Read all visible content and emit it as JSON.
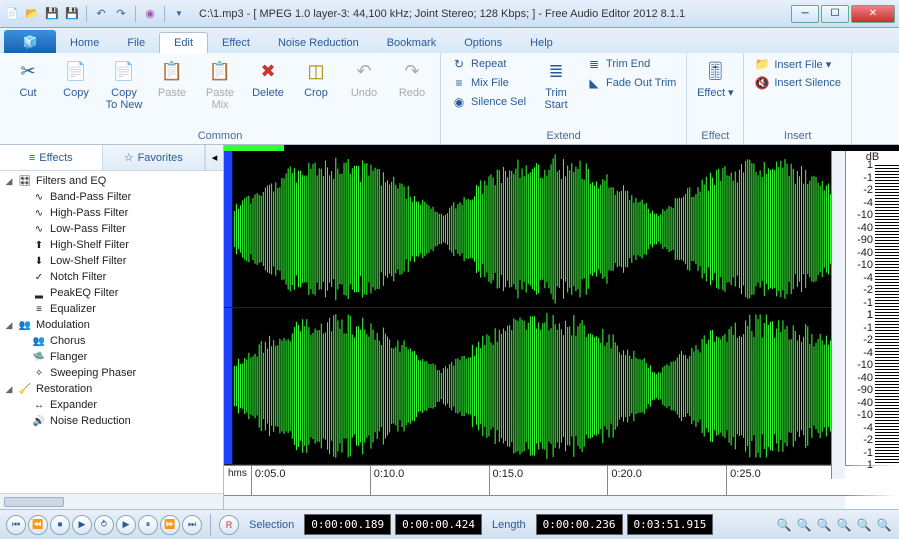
{
  "title": "C:\\1.mp3 - [ MPEG 1.0 layer-3: 44,100 kHz; Joint Stereo; 128 Kbps;  ] - Free Audio Editor 2012 8.1.1",
  "qat_icons": [
    "new",
    "open",
    "save",
    "disk",
    "undo",
    "redo",
    "cd",
    "help"
  ],
  "menu": {
    "tabs": [
      "Home",
      "File",
      "Edit",
      "Effect",
      "Noise Reduction",
      "Bookmark",
      "Options",
      "Help"
    ],
    "active": "Edit"
  },
  "ribbon": {
    "groups": [
      {
        "title": "Common",
        "big": [
          {
            "label": "Cut",
            "icon": "✂",
            "name": "cut-button"
          },
          {
            "label": "Copy",
            "icon": "📄",
            "name": "copy-button"
          },
          {
            "label": "Copy To New",
            "icon": "📄",
            "name": "copy-to-new-button"
          },
          {
            "label": "Paste",
            "icon": "📋",
            "name": "paste-button",
            "disabled": true
          },
          {
            "label": "Paste Mix",
            "icon": "📋",
            "name": "paste-mix-button",
            "disabled": true
          },
          {
            "label": "Delete",
            "icon": "✖",
            "name": "delete-button",
            "iconcolor": "#c33"
          },
          {
            "label": "Crop",
            "icon": "◫",
            "name": "crop-button",
            "iconcolor": "#a80"
          },
          {
            "label": "Undo",
            "icon": "↶",
            "name": "undo-button",
            "disabled": true
          },
          {
            "label": "Redo",
            "icon": "↷",
            "name": "redo-button",
            "disabled": true
          }
        ]
      },
      {
        "title": "Extend",
        "small": [
          {
            "label": "Repeat",
            "icon": "↻",
            "name": "repeat-button"
          },
          {
            "label": "Mix File",
            "icon": "≡",
            "name": "mix-file-button"
          },
          {
            "label": "Silence Sel",
            "icon": "◉",
            "name": "silence-sel-button"
          }
        ],
        "big": [
          {
            "label": "Trim Start",
            "icon": "≣",
            "name": "trim-start-button"
          }
        ],
        "small2": [
          {
            "label": "Trim End",
            "icon": "≣",
            "name": "trim-end-button"
          },
          {
            "label": "Fade Out Trim",
            "icon": "◣",
            "name": "fade-out-trim-button"
          }
        ]
      },
      {
        "title": "Effect",
        "big": [
          {
            "label": "Effect",
            "icon": "🎚",
            "name": "effect-button",
            "dropdown": true
          }
        ]
      },
      {
        "title": "Insert",
        "small": [
          {
            "label": "Insert File",
            "icon": "📁",
            "name": "insert-file-button",
            "dropdown": true
          },
          {
            "label": "Insert Silence",
            "icon": "🔇",
            "name": "insert-silence-button"
          }
        ]
      }
    ]
  },
  "sidebar": {
    "tabs": [
      {
        "label": "Effects",
        "icon": "≡",
        "name": "effects-tab"
      },
      {
        "label": "Favorites",
        "icon": "☆",
        "name": "favorites-tab"
      }
    ],
    "active": 0,
    "tree": [
      {
        "cat": "Filters and EQ",
        "icon": "🎛",
        "children": [
          {
            "label": "Band-Pass Filter",
            "icon": "∿"
          },
          {
            "label": "High-Pass Filter",
            "icon": "∿"
          },
          {
            "label": "Low-Pass Filter",
            "icon": "∿"
          },
          {
            "label": "High-Shelf Filter",
            "icon": "⬆"
          },
          {
            "label": "Low-Shelf Filter",
            "icon": "⬇"
          },
          {
            "label": "Notch Filter",
            "icon": "✓"
          },
          {
            "label": "PeakEQ Filter",
            "icon": "▂"
          },
          {
            "label": "Equalizer",
            "icon": "≡"
          }
        ]
      },
      {
        "cat": "Modulation",
        "icon": "👥",
        "children": [
          {
            "label": "Chorus",
            "icon": "👥"
          },
          {
            "label": "Flanger",
            "icon": "🛸"
          },
          {
            "label": "Sweeping Phaser",
            "icon": "✧"
          }
        ]
      },
      {
        "cat": "Restoration",
        "icon": "🧹",
        "children": [
          {
            "label": "Expander",
            "icon": "↔"
          },
          {
            "label": "Noise Reduction",
            "icon": "🔊"
          }
        ]
      }
    ]
  },
  "db_header": "dB",
  "db_labels": [
    "1",
    "-1",
    "-2",
    "-4",
    "-10",
    "-40",
    "-90",
    "-40",
    "-10",
    "-4",
    "-2",
    "-1",
    "1"
  ],
  "time_ruler": {
    "unit": "hms",
    "ticks": [
      "0:05.0",
      "0:10.0",
      "0:15.0",
      "0:20.0",
      "0:25.0"
    ]
  },
  "transport": {
    "buttons": [
      "start",
      "rew",
      "stop",
      "play",
      "play-loop",
      "play-sel",
      "pause",
      "ffwd",
      "end",
      "rec"
    ],
    "selection_label": "Selection",
    "selection_start": "0:00:00.189",
    "selection_end": "0:00:00.424",
    "length_label": "Length",
    "length_sel": "0:00:00.236",
    "length_total": "0:03:51.915"
  },
  "zoom_icons": [
    "zoom-in",
    "zoom-out",
    "zoom-sel",
    "zoom-full",
    "zoom-v-in",
    "zoom-v-out"
  ],
  "chart_data": {
    "type": "waveform",
    "channels": 2,
    "duration_seconds": 231.915,
    "view_start": 0,
    "view_end": 30,
    "y_unit": "dB",
    "y_ticks": [
      1,
      -1,
      -2,
      -4,
      -10,
      -40,
      -90
    ],
    "note": "stereo audio waveform; visual envelope approximated"
  }
}
